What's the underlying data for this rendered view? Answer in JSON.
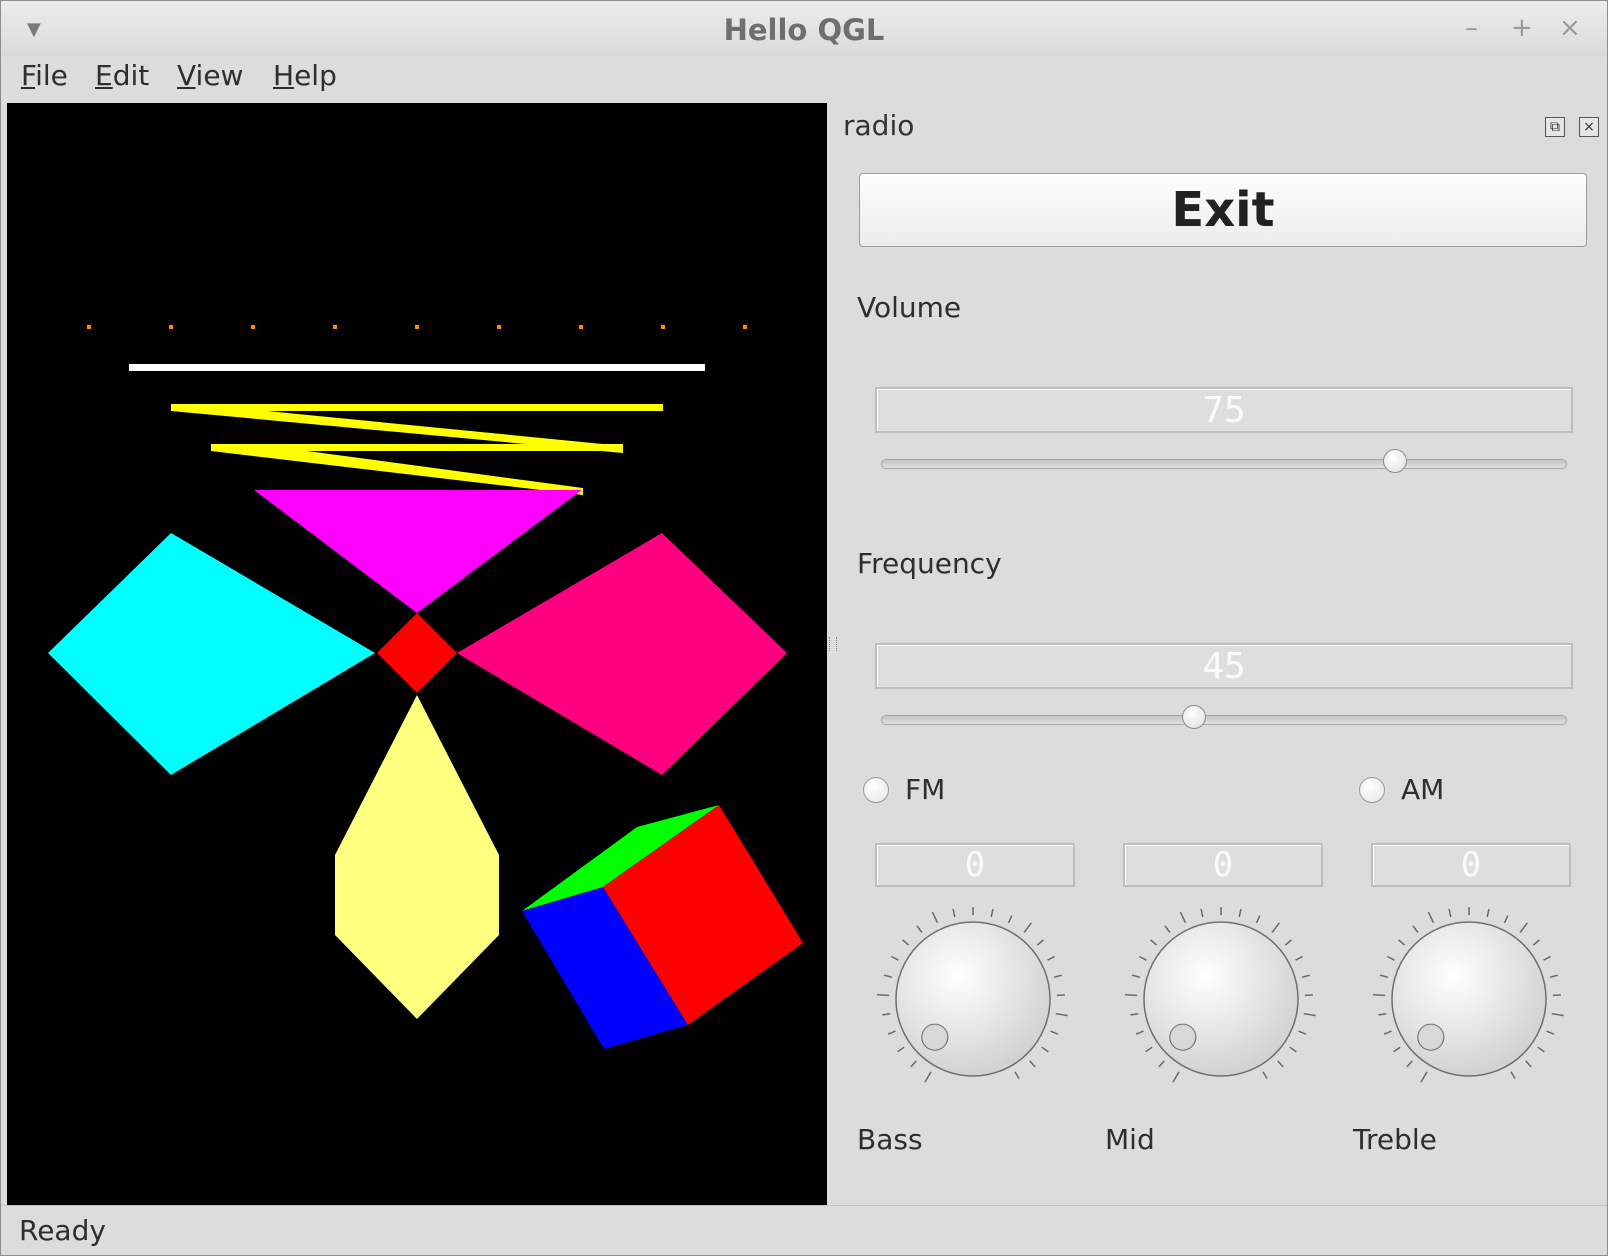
{
  "window": {
    "title": "Hello QGL"
  },
  "menu": {
    "items": [
      {
        "mnemonic": "F",
        "rest": "ile"
      },
      {
        "mnemonic": "E",
        "rest": "dit"
      },
      {
        "mnemonic": "V",
        "rest": "iew"
      },
      {
        "mnemonic": "H",
        "rest": "elp"
      }
    ]
  },
  "dock": {
    "title": "radio",
    "exit_label": "Exit",
    "volume": {
      "label": "Volume",
      "value": 75,
      "display": "75"
    },
    "frequency": {
      "label": "Frequency",
      "value": 45,
      "display": "45"
    },
    "band": {
      "fm_label": "FM",
      "am_label": "AM",
      "fm_checked": false,
      "am_checked": false
    },
    "knobs": [
      {
        "label": "Bass",
        "value": 0,
        "display": "0"
      },
      {
        "label": "Mid",
        "value": 0,
        "display": "0"
      },
      {
        "label": "Treble",
        "value": 0,
        "display": "0"
      }
    ]
  },
  "status": {
    "text": "Ready"
  },
  "colors": {
    "gl_background": "#000000",
    "points": "#ff8c00",
    "line": "#ffffff",
    "zigzag": "#ffff00",
    "triangle": "#ff00ff",
    "left_quad": "#00ffff",
    "right_quad": "#ff0080",
    "center_quad": "#ff0000",
    "polygon": "#ffff80",
    "cube_top": "#00ff00",
    "cube_front": "#0000ff",
    "cube_side": "#ff0000"
  }
}
